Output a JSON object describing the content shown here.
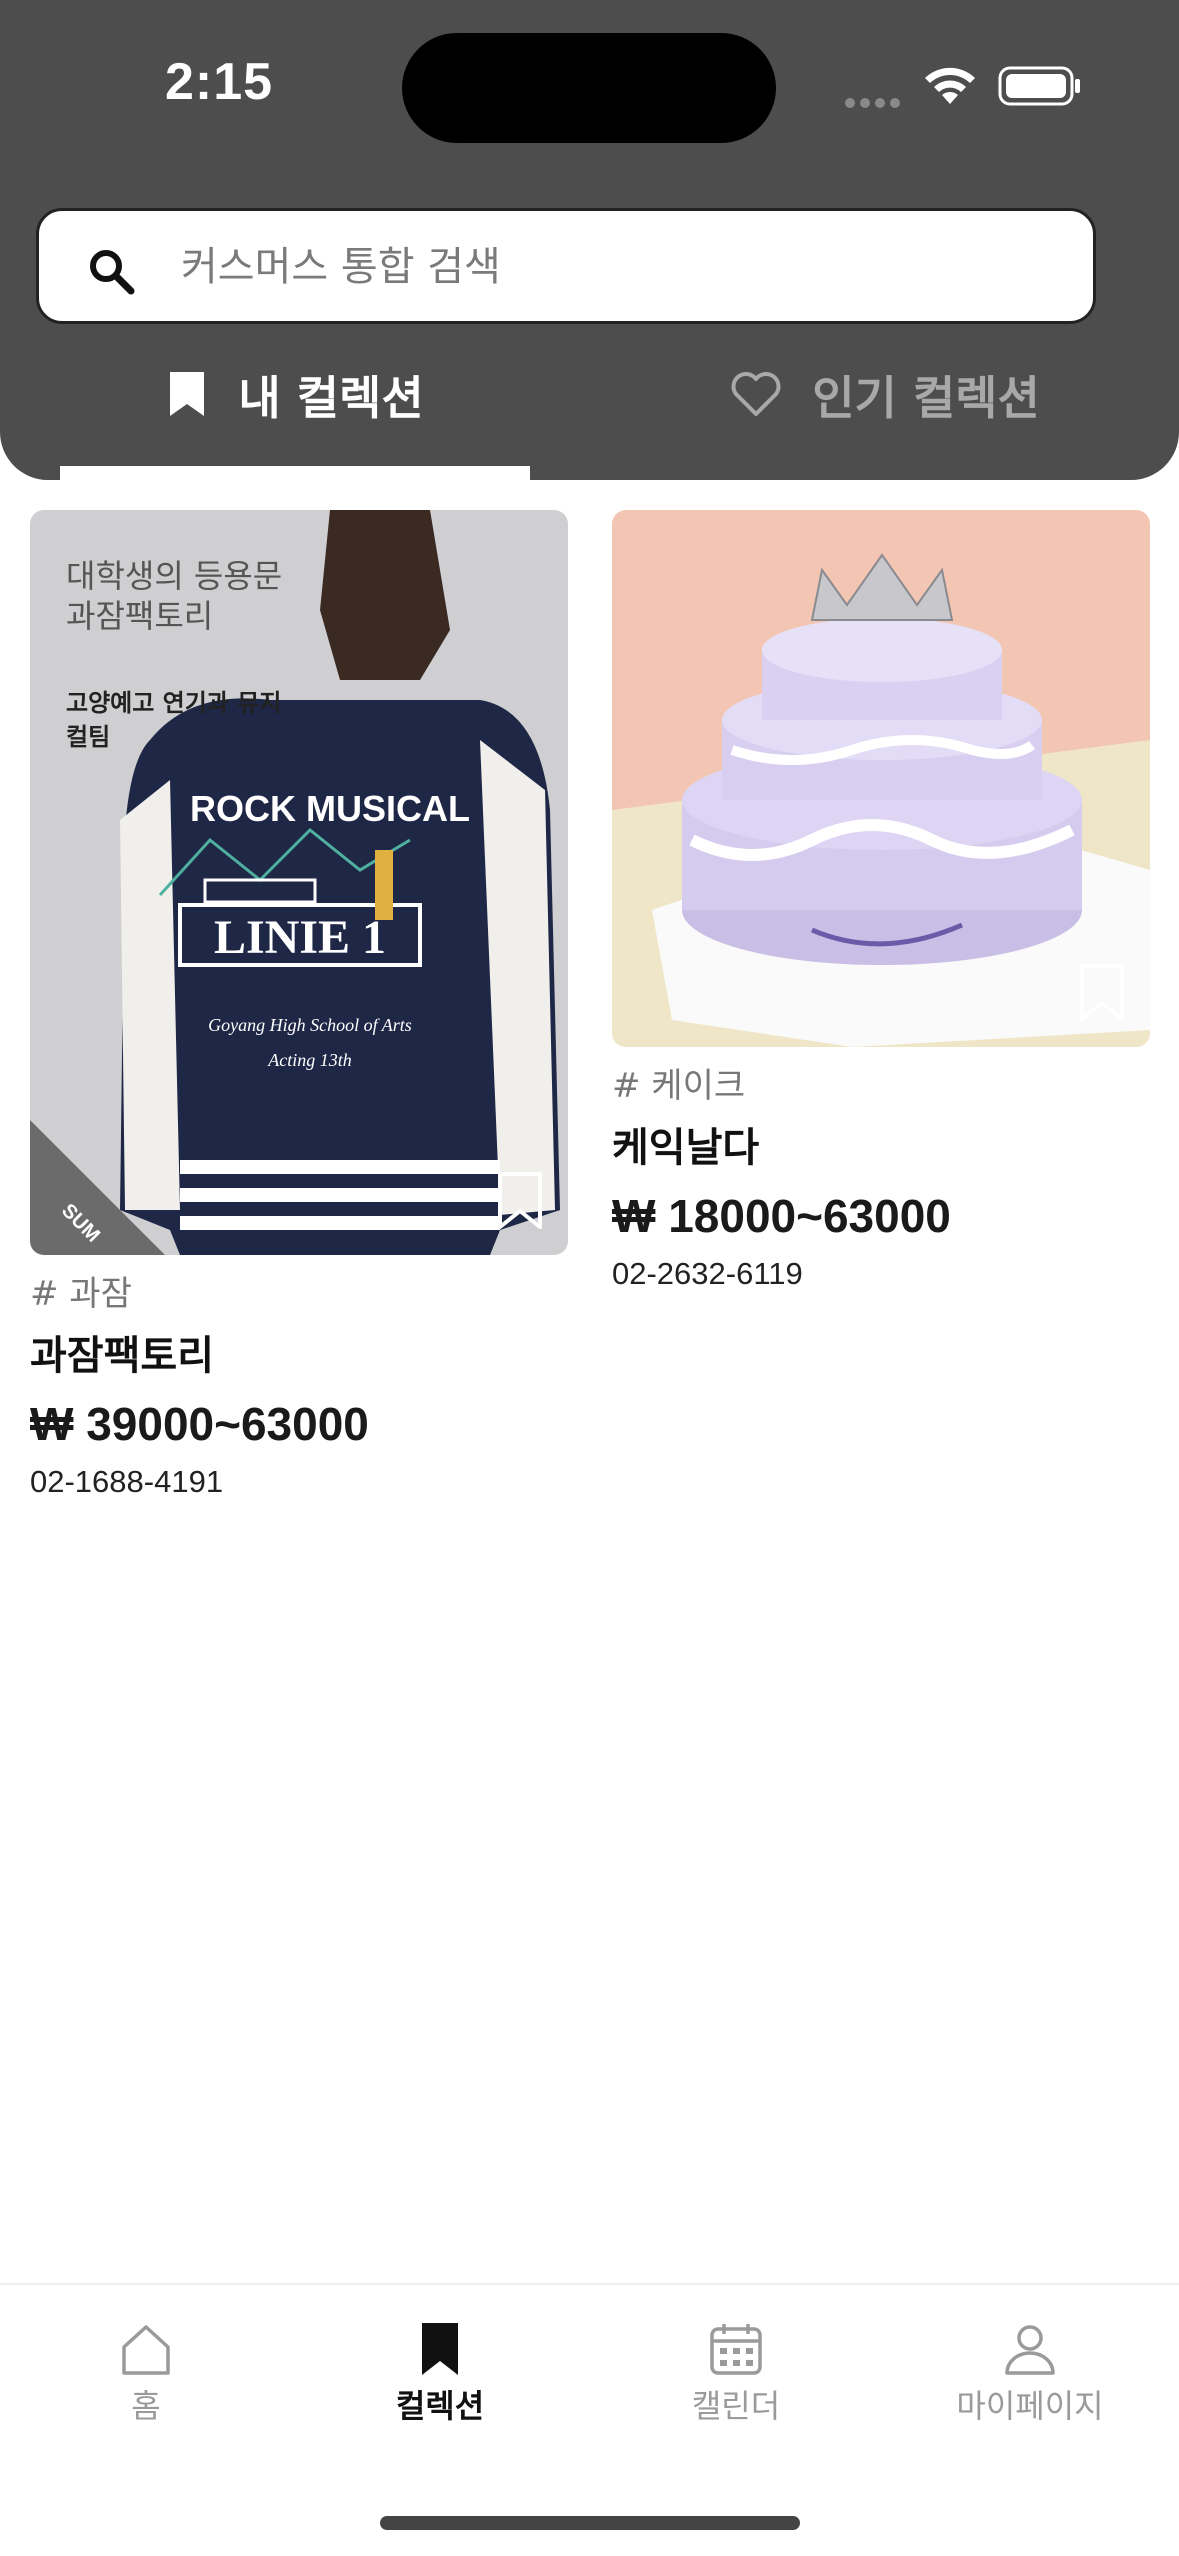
{
  "status_bar": {
    "time": "2:15"
  },
  "search": {
    "placeholder": "커스머스 통합 검색"
  },
  "tabs": [
    {
      "label": "내 컬렉션",
      "icon": "bookmark-icon",
      "active": true
    },
    {
      "label": "인기 컬렉션",
      "icon": "heart-icon",
      "active": false
    }
  ],
  "products": [
    {
      "tag": "# 과잠",
      "name": "과잠팩토리",
      "price": "₩ 39000~63000",
      "phone": "02-1688-4191",
      "image": {
        "overlay_title": "대학생의 등용문 과잠팩토리",
        "overlay_subtitle": "고양예고 연기과 뮤지컬팀",
        "jacket_text_1": "ROCK MUSICAL",
        "jacket_text_2": "LINIE 1",
        "jacket_text_3": "Goyang High School of Arts",
        "jacket_text_4": "Acting 13th",
        "brand": "SUM"
      }
    },
    {
      "tag": "# 케이크",
      "name": "케익날다",
      "price": "₩ 18000~63000",
      "phone": "02-2632-6119"
    }
  ],
  "bottom_nav": [
    {
      "label": "홈",
      "icon": "home-icon",
      "active": false
    },
    {
      "label": "컬렉션",
      "icon": "bookmark-icon",
      "active": true
    },
    {
      "label": "캘린더",
      "icon": "calendar-icon",
      "active": false
    },
    {
      "label": "마이페이지",
      "icon": "person-icon",
      "active": false
    }
  ],
  "colors": {
    "header_bg": "#4d4d4d",
    "active_tab_text": "#ffffff",
    "inactive_tab_text": "#a8a8a8",
    "accent": "#111111"
  }
}
